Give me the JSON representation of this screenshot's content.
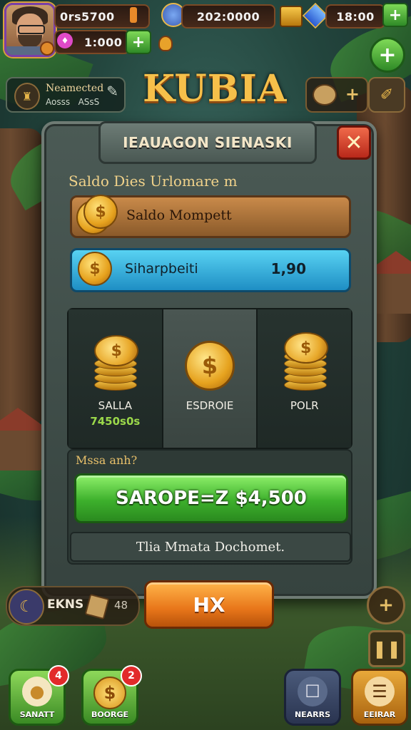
{
  "hud": {
    "gold": "0rs5700",
    "gems": "1:000",
    "center_value": "202:0000",
    "right_value": "18:00",
    "plus_symbol": "+"
  },
  "quest": {
    "title": "Neamected",
    "subtitle": "Aosss",
    "subtitle2": "ASsS"
  },
  "game_title": "KUBIA",
  "dialog": {
    "title": "IEAUAGON SIENASKI",
    "close_symbol": "✕",
    "section_label": "Saldo Dies Urlomare m",
    "balance_label": "Saldo Mompett",
    "exchange_label": "Siharpbeiti",
    "exchange_value": "1,90",
    "options": [
      {
        "label": "SALLA",
        "amount": "7450s0s"
      },
      {
        "label": "ESDROIE",
        "amount": ""
      },
      {
        "label": "POLR",
        "amount": ""
      }
    ],
    "confirm_hint": "Mssa anh?",
    "confirm_button": "SAROPE=Z $4,500",
    "info_text": "Tlia Mmata Dochomet."
  },
  "hx_button": "HX",
  "left_pill": {
    "label": "EKNS",
    "count": "48"
  },
  "bottom": {
    "left1": {
      "label": "SANATT",
      "badge": "4"
    },
    "left2": {
      "label": "BOORGE",
      "badge": "2"
    },
    "right1": {
      "label": "NEARRS"
    },
    "right2": {
      "label": "EEIRAR"
    }
  },
  "colors": {
    "accent_green": "#3db02c",
    "accent_orange": "#e8761a",
    "accent_blue": "#1e8ec4",
    "title_gold": "#f6c04a",
    "close_red": "#b8281a"
  },
  "icons": {
    "coin": "dollar-coin-icon",
    "gem": "gem-icon",
    "chest": "chest-icon",
    "shield": "shield-icon",
    "pause": "pause-icon"
  }
}
